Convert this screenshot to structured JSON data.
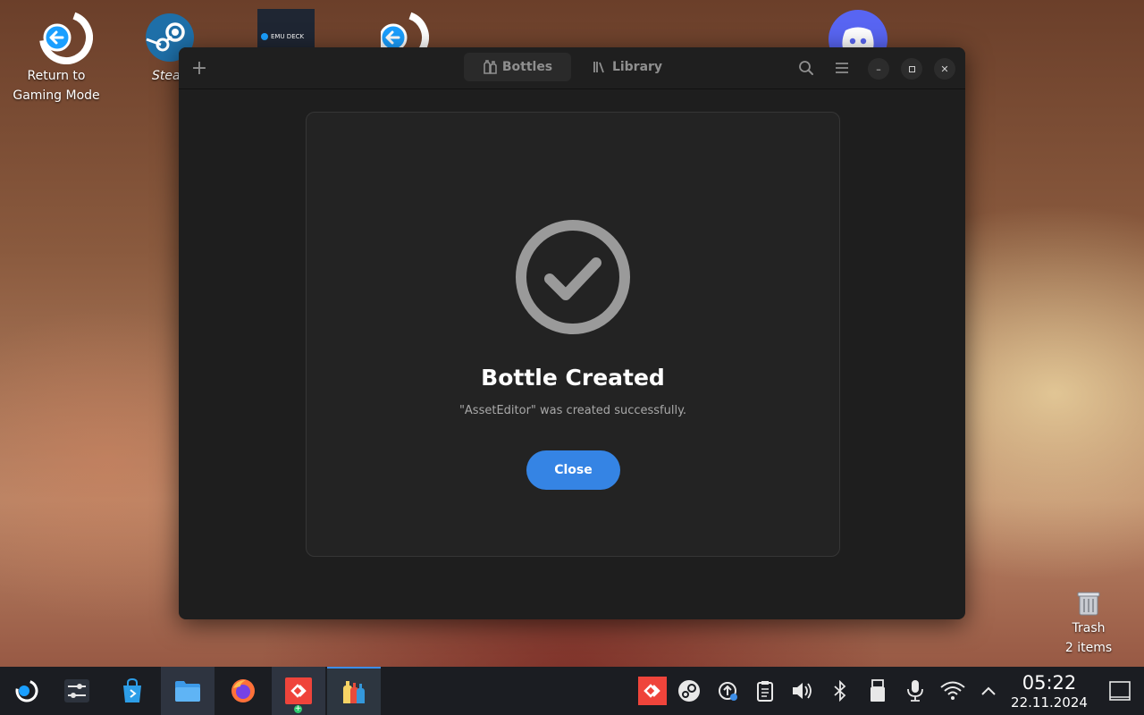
{
  "desktop": {
    "icons": [
      {
        "label": "Return to\nGaming Mode"
      },
      {
        "label": "Stea"
      },
      {
        "label": "EMU DECK"
      }
    ],
    "trash": {
      "label": "Trash",
      "count": "2 items"
    }
  },
  "window": {
    "tabs": [
      {
        "label": "Bottles"
      },
      {
        "label": "Library"
      }
    ]
  },
  "dialog": {
    "title": "Bottle Created",
    "description": "\"AssetEditor\" was created successfully.",
    "close_label": "Close"
  },
  "taskbar": {
    "time": "05:22",
    "date": "22.11.2024"
  },
  "colors": {
    "accent": "#3584e4",
    "window_bg": "#1e1e1e",
    "dialog_bg": "#232323",
    "taskbar_bg": "#1b1d22"
  }
}
